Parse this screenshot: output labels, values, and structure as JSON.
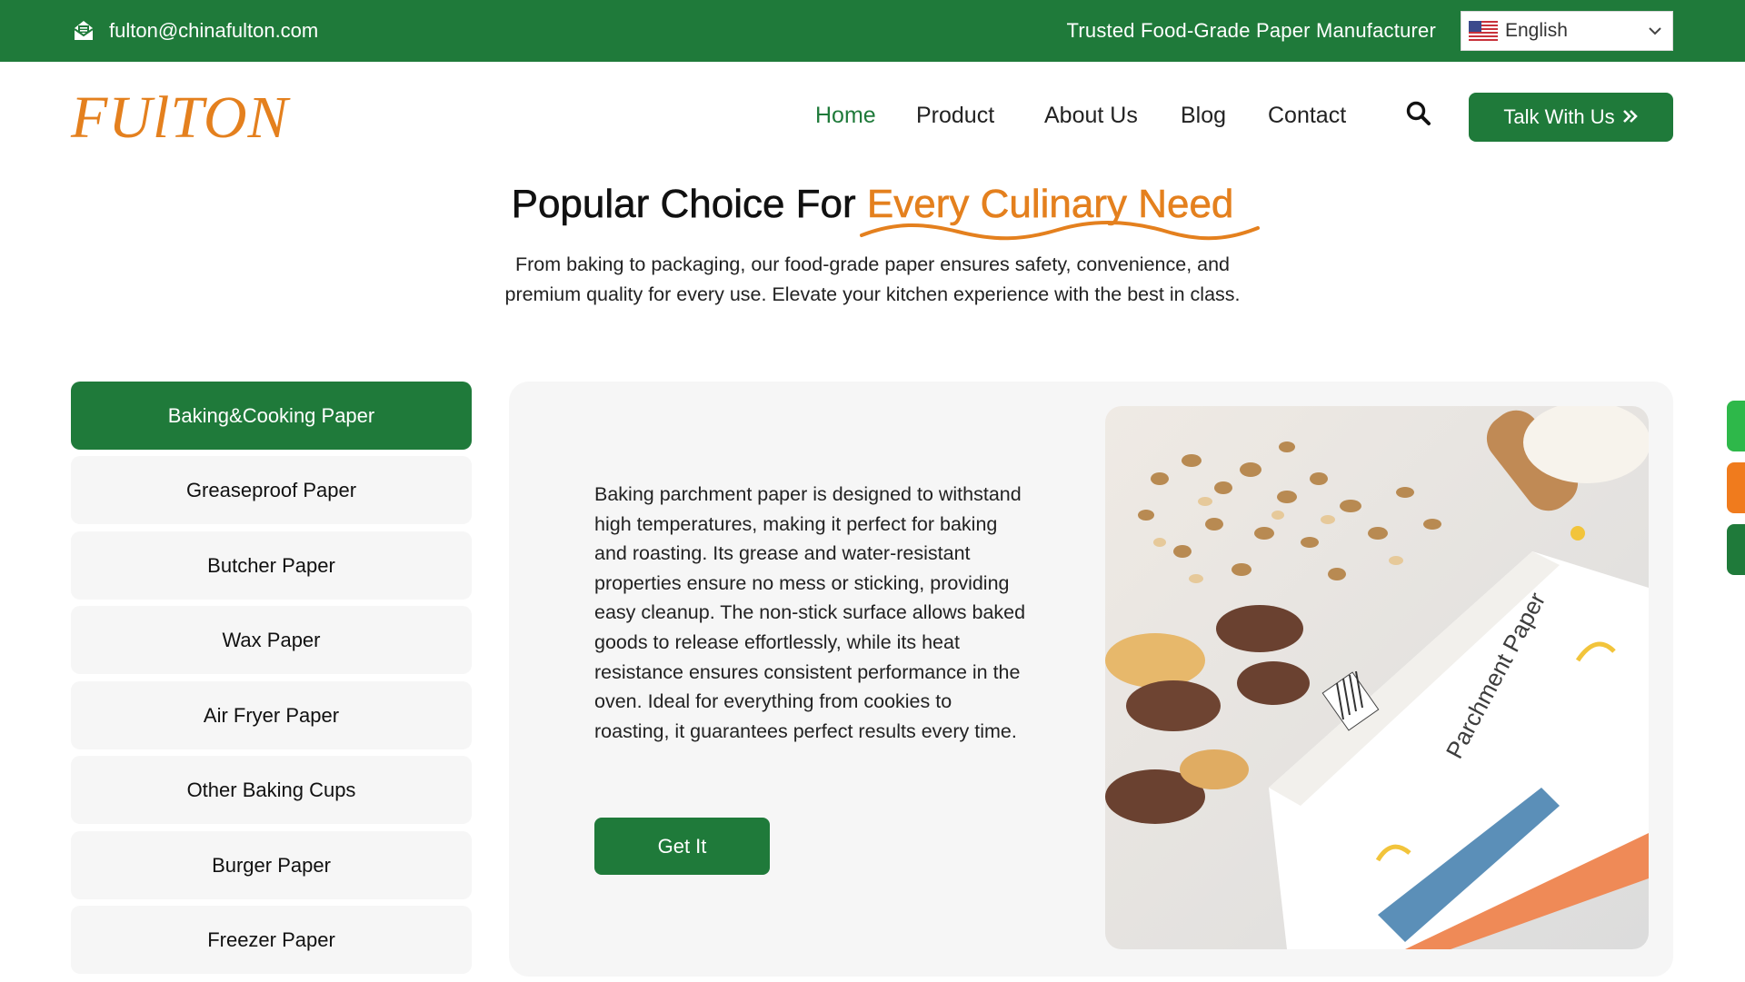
{
  "topbar": {
    "email": "fulton@chinafulton.com",
    "email_icon": "mail-icon",
    "tagline": "Trusted Food-Grade Paper Manufacturer",
    "language": {
      "selected": "English",
      "flag_icon": "us-flag-icon"
    }
  },
  "header": {
    "logo_text": "FUlTON",
    "nav": [
      {
        "label": "Home",
        "active": true
      },
      {
        "label": "Product",
        "active": false
      },
      {
        "label": "About Us",
        "active": false
      },
      {
        "label": "Blog",
        "active": false
      },
      {
        "label": "Contact",
        "active": false
      }
    ],
    "cta_label": "Talk With Us"
  },
  "hero": {
    "title_prefix": "Popular Choice For",
    "title_accent": "Every Culinary Need",
    "subtitle": "From baking to packaging, our food-grade paper ensures safety, convenience, and premium quality for every use. Elevate your kitchen experience with the best in class."
  },
  "categories": [
    {
      "label": "Baking&Cooking Paper",
      "active": true
    },
    {
      "label": "Greaseproof Paper",
      "active": false
    },
    {
      "label": "Butcher Paper",
      "active": false
    },
    {
      "label": "Wax Paper",
      "active": false
    },
    {
      "label": "Air Fryer Paper",
      "active": false
    },
    {
      "label": "Other Baking Cups",
      "active": false
    },
    {
      "label": "Burger Paper",
      "active": false
    },
    {
      "label": "Freezer Paper",
      "active": false
    }
  ],
  "detail": {
    "description": "Baking parchment paper is designed to withstand high temperatures, making it perfect for baking and roasting. Its grease and water-resistant properties ensure no mess or sticking, providing easy cleanup. The non-stick surface allows baked goods to release effortlessly, while its heat resistance ensures consistent performance in the oven. Ideal for everything from cookies to roasting, it guarantees perfect results every time.",
    "button_label": "Get It",
    "box_print_text": "Parchment Paper"
  },
  "colors": {
    "brand_green": "#1f7a3a",
    "accent_orange": "#e4801e",
    "panel_gray": "#f6f6f6"
  },
  "floating_actions": [
    {
      "icon": "chat-icon",
      "color": "#2eb84a"
    },
    {
      "icon": "email-icon",
      "color": "#f07b1d"
    },
    {
      "icon": "phone-icon",
      "color": "#1f7a3a"
    }
  ]
}
